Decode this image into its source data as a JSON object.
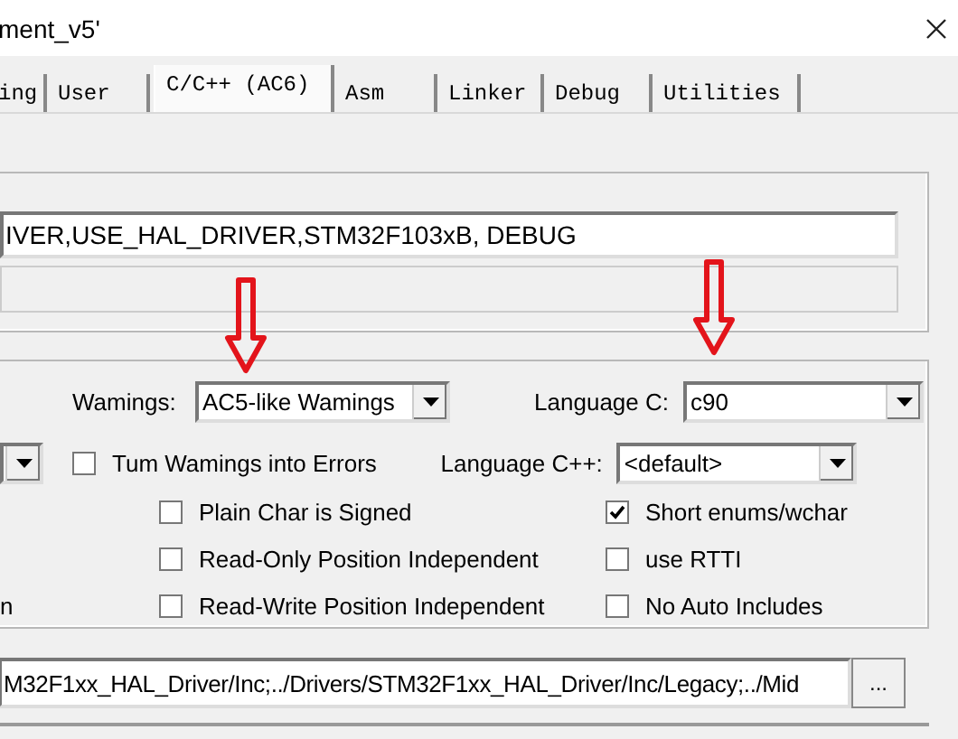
{
  "window": {
    "title": "ment_v5'"
  },
  "tabs": [
    {
      "label": "ing",
      "selected": false
    },
    {
      "label": "User",
      "selected": false
    },
    {
      "label": "C/C++ (AC6)",
      "selected": true
    },
    {
      "label": "Asm",
      "selected": false
    },
    {
      "label": "Linker",
      "selected": false
    },
    {
      "label": "Debug",
      "selected": false
    },
    {
      "label": "Utilities",
      "selected": false
    }
  ],
  "preprocessor": {
    "define": "IVER,USE_HAL_DRIVER,STM32F103xB, DEBUG"
  },
  "code_generation": {
    "warnings_label": "Wamings:",
    "warnings": "AC5-like Wamings",
    "language_c_label": "Language C:",
    "language_c": "c90",
    "language_cpp_label": "Language C++:",
    "language_cpp": "<default>",
    "cut_label": "n",
    "left_options": [
      {
        "label": "Tum Wamings into Errors",
        "checked": false
      },
      {
        "label": "Plain Char is Signed",
        "checked": false
      },
      {
        "label": "Read-Only Position Independent",
        "checked": false
      },
      {
        "label": "Read-Write Position Independent",
        "checked": false
      }
    ],
    "right_options": [
      {
        "label": "Short enums/wchar",
        "checked": true
      },
      {
        "label": "use RTTI",
        "checked": false
      },
      {
        "label": "No Auto Includes",
        "checked": false
      }
    ]
  },
  "include_paths": {
    "value": "M32F1xx_HAL_Driver/Inc;../Drivers/STM32F1xx_HAL_Driver/Inc/Legacy;../Mid",
    "browse_button": "..."
  }
}
